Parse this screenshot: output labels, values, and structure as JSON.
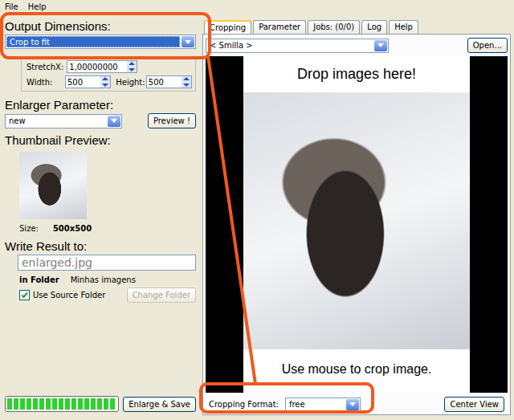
{
  "menu": [
    "File",
    "Help"
  ],
  "left": {
    "output_dimensions": {
      "label": "Output Dimensions:",
      "value": "Crop to fit",
      "highlighted": true
    },
    "stretch": {
      "label": "StretchX:",
      "value": "1,00000000"
    },
    "width": {
      "label": "Width:",
      "value": "500"
    },
    "height": {
      "label": "Height:",
      "value": "500"
    },
    "enlarger": {
      "label": "Enlarger Parameter:",
      "value": "new",
      "button": "Preview !"
    },
    "thumbnail": {
      "label": "Thumbnail Preview:",
      "size_label": "Size:",
      "size": "500x500"
    },
    "output": {
      "label": "Write Result to:",
      "filename": "enlarged.jpg",
      "folder_label": "in Folder",
      "folder": "Minhas imagens",
      "use_source": {
        "label": "Use Source Folder",
        "checked": true
      },
      "change_folder": {
        "label": "Change Folder",
        "disabled": true
      }
    },
    "progress": {
      "level": 1
    },
    "enlarge_button": "Enlarge & Save"
  },
  "tabs": [
    {
      "label": "Cropping",
      "selected": true
    },
    {
      "label": "Parameter",
      "selected": false
    },
    {
      "label": "Jobs: (0/0)",
      "selected": false
    },
    {
      "label": "Log",
      "selected": false
    },
    {
      "label": "Help",
      "selected": false
    }
  ],
  "preset": {
    "value": "< Smilla >",
    "button": "Open..."
  },
  "canvas": {
    "top_text": "Drop images here!",
    "bottom_text": "Use mouse to crop image."
  },
  "cropping_format": {
    "label": "Cropping Format:",
    "value": "free"
  },
  "center_button": "Center View"
}
